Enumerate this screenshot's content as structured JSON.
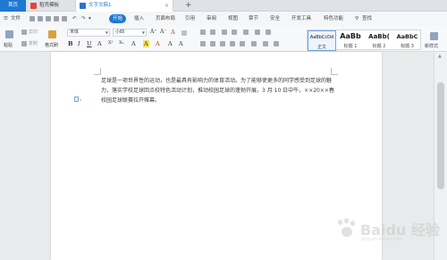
{
  "tabs": {
    "home": "首页",
    "items": [
      {
        "label": "稻壳模板"
      },
      {
        "label": "文字文稿1"
      }
    ],
    "new_tab": "+"
  },
  "menu": {
    "file": "文件",
    "items": [
      "开始",
      "插入",
      "页面布局",
      "引用",
      "审阅",
      "视图",
      "章节",
      "安全",
      "开发工具",
      "特色功能"
    ],
    "active": "开始",
    "search": "查找"
  },
  "ribbon": {
    "paste": "粘贴",
    "cut": "剪切",
    "copy": "复制",
    "format_painter": "格式刷",
    "font_name": "宋体",
    "font_size": "小四",
    "font_grow": "A⁺",
    "font_shrink": "A⁻",
    "clear_format": "A",
    "styles": [
      {
        "preview": "AaBbCcDd",
        "name": "正文"
      },
      {
        "preview": "AaBb",
        "name": "标题 1"
      },
      {
        "preview": "AaBb(",
        "name": "标题 2"
      },
      {
        "preview": "AaBbC",
        "name": "标题 3"
      }
    ],
    "new_style": "新样式"
  },
  "document": {
    "paragraph": "足球是一项世界性的运动，也是最具有影响力的体育活动。为了能够使更多的同学感受到足球的魅力，落实学校足球回点校特色活动计划，推动校园足球的蓬勃开展，3 月 10 日中午，××20××春校园足球联赛拉开帷幕。"
  },
  "watermark": {
    "title": "Baidu 经验",
    "sub": "jingyan.baidu.com"
  }
}
